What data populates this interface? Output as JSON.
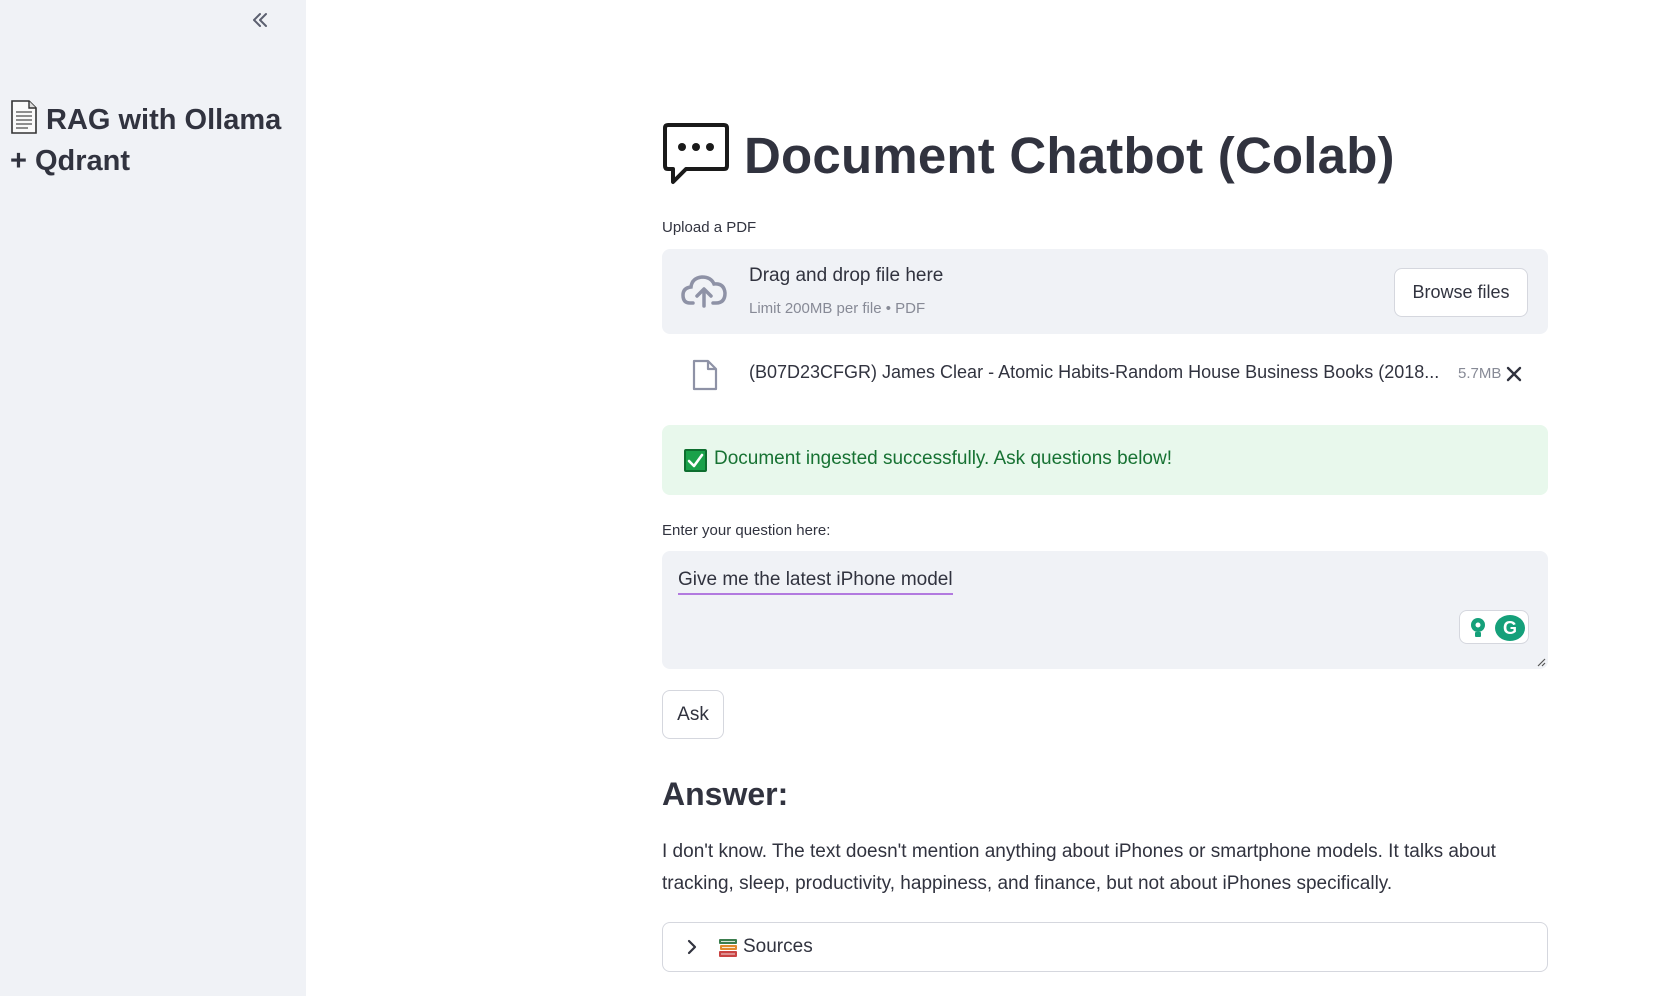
{
  "sidebar": {
    "title": "RAG with Ollama + Qdrant",
    "title_icon": "page-icon",
    "collapse_icon": "double-chevron-left-icon"
  },
  "main": {
    "title": "Document Chatbot (Colab)",
    "title_icon": "speech-bubble-icon",
    "uploader": {
      "label": "Upload a PDF",
      "drop_text": "Drag and drop file here",
      "limit_text": "Limit 200MB per file • PDF",
      "browse_label": "Browse files",
      "file": {
        "name": "(B07D23CFGR) James Clear - Atomic Habits-Random House Business Books (2018...",
        "size": "5.7MB"
      }
    },
    "success_message": "Document ingested successfully. Ask questions below!",
    "question": {
      "label": "Enter your question here:",
      "value": "Give me the latest iPhone model"
    },
    "ask_label": "Ask",
    "answer": {
      "heading": "Answer:",
      "text": "I don't know. The text doesn't mention anything about iPhones or smartphone models. It talks about tracking, sleep, productivity, happiness, and finance, but not about iPhones specifically."
    },
    "sources_label": "Sources"
  },
  "colors": {
    "sidebar_bg": "#f0f2f6",
    "success_bg": "#e8f8ec",
    "success_text": "#177233",
    "text": "#31333f"
  }
}
